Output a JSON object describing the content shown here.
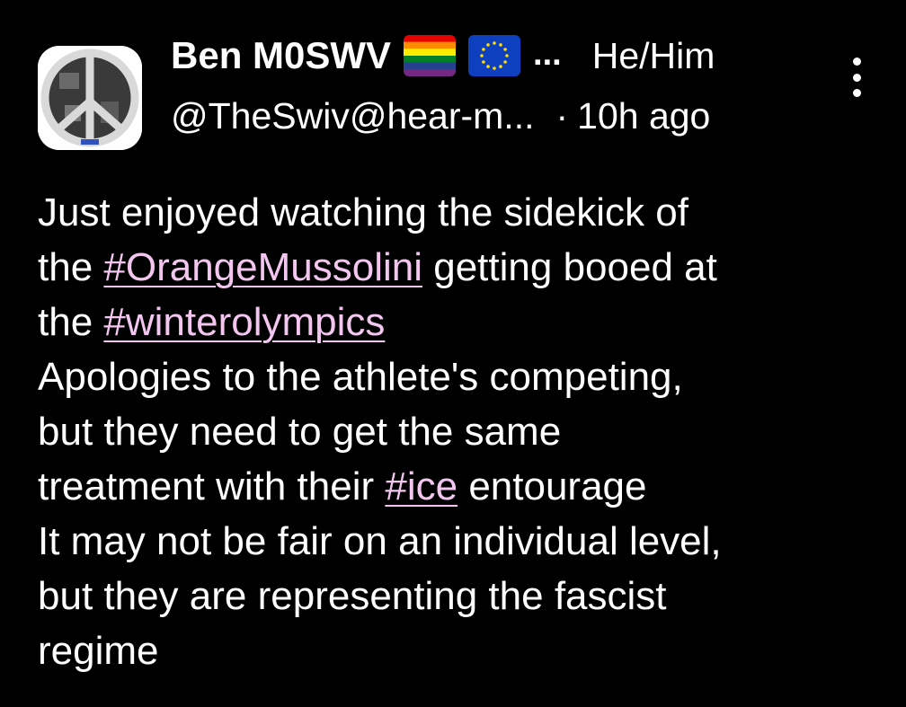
{
  "post": {
    "display_name": "Ben M0SWV",
    "name_ellipsis": "...",
    "pronouns": "He/Him",
    "handle": "@TheSwiv@hear-m...",
    "separator": "·",
    "timestamp": "10h ago",
    "flags": [
      "rainbow-pride-flag-icon",
      "eu-flag-icon"
    ],
    "avatar_icon": "peace-symbol-avatar",
    "more_icon": "more-vertical-icon",
    "content_lines": [
      [
        {
          "t": "Just enjoyed watching the sidekick of"
        }
      ],
      [
        {
          "t": "the "
        },
        {
          "t": "#OrangeMussolini",
          "hashtag": true
        },
        {
          "t": " getting booed at"
        }
      ],
      [
        {
          "t": "the "
        },
        {
          "t": "#winterolympics",
          "hashtag": true
        }
      ],
      [
        {
          "t": "Apologies to the athlete's competing,"
        }
      ],
      [
        {
          "t": "but they need to get the same"
        }
      ],
      [
        {
          "t": "treatment with their "
        },
        {
          "t": "#ice",
          "hashtag": true
        },
        {
          "t": " entourage"
        }
      ],
      [
        {
          "t": "It may not be fair on an individual level,"
        }
      ],
      [
        {
          "t": "but they are representing the fascist"
        }
      ],
      [
        {
          "t": "regime"
        }
      ]
    ]
  },
  "colors": {
    "background": "#000000",
    "text": "#ffffff",
    "hashtag": "#f3c6ef"
  }
}
